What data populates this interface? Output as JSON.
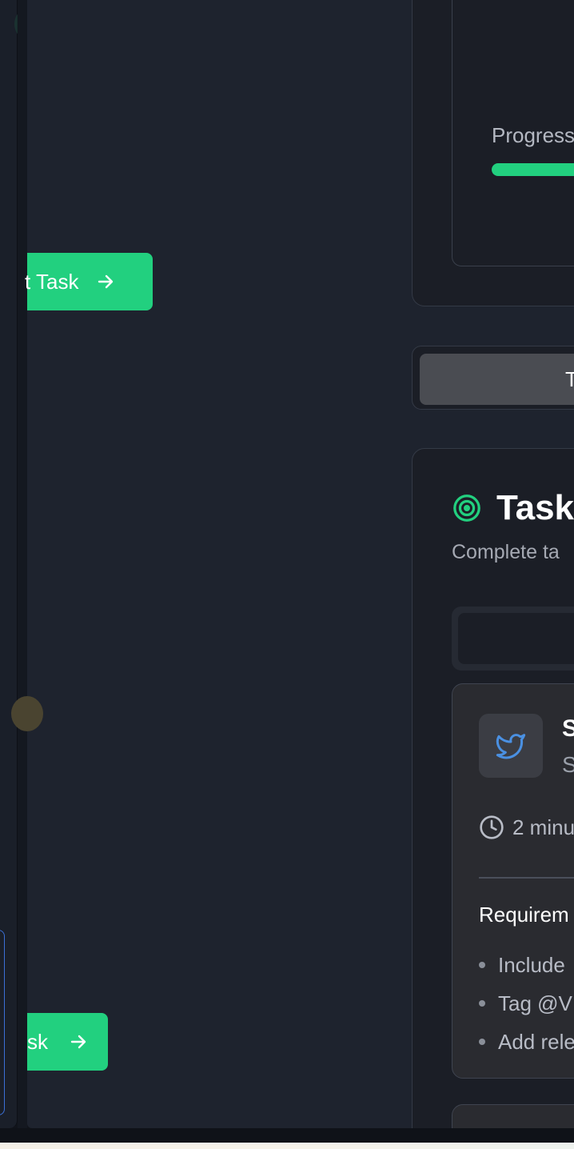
{
  "left_panel": {
    "start_button_label": "t Task",
    "bottom_button_label": "sk"
  },
  "overview": {
    "progress_label": "Progress",
    "progress_fraction": 1.0
  },
  "tabs": {
    "active_label": "Ta"
  },
  "tasks": {
    "title": "Task",
    "subtitle": "Complete ta",
    "task": {
      "name": "S",
      "description": "S",
      "time": "2 minu",
      "requirements_title": "Requirem",
      "requirements": [
        "Include",
        "Tag @V",
        "Add rele"
      ]
    }
  },
  "colors": {
    "accent": "#22d07f",
    "twitter_blue": "#4a90e2",
    "background": "#1e232e"
  },
  "icons": {
    "arrow": "arrow-right-icon",
    "target": "target-icon",
    "twitter": "twitter-icon",
    "clock": "clock-icon"
  }
}
